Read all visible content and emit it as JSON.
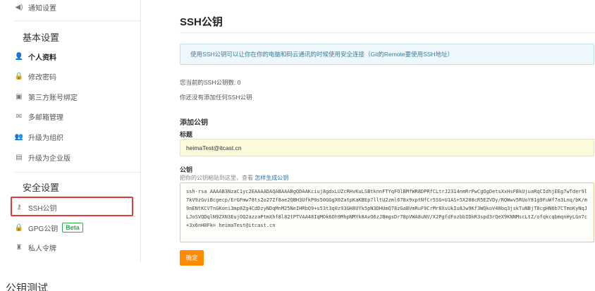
{
  "sidebar": {
    "notifications": "通知设置",
    "basic_title": "基本设置",
    "items": [
      {
        "label": "个人资料",
        "icon": "user-icon"
      },
      {
        "label": "修改密码",
        "icon": "lock-icon"
      },
      {
        "label": "第三方账号绑定",
        "icon": "link-icon"
      },
      {
        "label": "多邮箱管理",
        "icon": "mail-icon"
      },
      {
        "label": "升级为组织",
        "icon": "group-icon"
      },
      {
        "label": "升级为企业版",
        "icon": "building-icon"
      }
    ],
    "security_title": "安全设置",
    "security_items": [
      {
        "label": "SSH公钥",
        "icon": "key-icon"
      },
      {
        "label": "GPG公钥",
        "icon": "lock-icon",
        "badge": "Beta"
      },
      {
        "label": "私人令牌",
        "icon": "token-icon"
      }
    ]
  },
  "main": {
    "title": "SSH公钥",
    "info": "使用SSH公钥可以让你在你的电脑和码云通讯的时候使用安全连接（Git的Remote要使用SSH地址）",
    "count_text": "您当前的SSH公钥数: 0",
    "empty_text": "你还没有添加任何SSH公钥",
    "add_heading": "添加公钥",
    "title_label": "标题",
    "title_value": "heimaTest@itcast.cn",
    "key_label": "公钥",
    "hint_text": "把你的公钥粘贴到这里，查看",
    "hint_link": "怎样生成公钥",
    "key_value": "ssh-rsa AAAAB3NzaC1yc2EAAAADAQABAAABgQDAAKciuj8gdxLUZcRHvKuLSBtknnFTYqFOlBMfWR8DPRfCLtrJ2314nmRrPwCgOgDetsXxHsFBkUjuaRqCIdhjEEg7wTder9l7kV9zGviBcgecp/ErGFmw78ts2o27Zf8ae2QBH3UfkP0s50GGgX0ZatpKaKBEp7lltU2zml678x9xptNfCr5SG+U1AS+5X208cR5EZVDy/RQWwv5RUoY81g9FuWf7a3Lnq/bK/m9nENtKCVTnGKoni3mp8Zg4CdDzyNDqMnM25NeIHRbQ9+s53t3q0z93GH8UYk5pN3DHUmQ78zGaBVmRuF9CrMr8XsUkIu8Jw9Kf3WQkoV48bq3jskTuNBjT8cgHN6b7CTmoKyNqJLJoSVQDqlN9ZXN3EujOQ2azzaPtmXhf8l82tPTVAA48IqMOk6Oh9MhpNMYk8AvO6zJBmgsDr78pVWA8uNV/X2PgfdFozbbIDkR3spd3rQeX9KNNMscLtZ/ofqkcqbmqnHyLGn7c+3x6nH0Fk= heimaTest@itcast.cn",
    "confirm_label": "确定"
  },
  "page_bottom_text": "公钥测试",
  "colors": {
    "accent": "#ff8a00",
    "highlight": "#e03a3a",
    "beta": "#2fa84f",
    "link": "#2a6fb0"
  }
}
